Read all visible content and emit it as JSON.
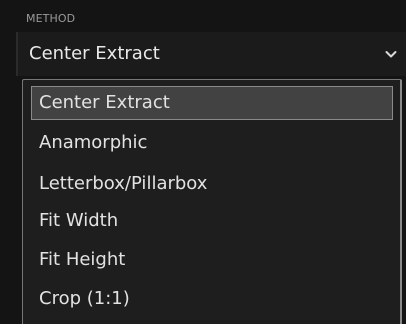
{
  "method": {
    "label": "METHOD",
    "selected_value": "Center Extract",
    "chevron_icon": "chevron-down-icon",
    "options": [
      {
        "label": "Center Extract",
        "selected": true
      },
      {
        "label": "Anamorphic",
        "selected": false
      },
      {
        "label": "Letterbox/Pillarbox",
        "selected": false
      },
      {
        "label": "Fit Width",
        "selected": false
      },
      {
        "label": "Fit Height",
        "selected": false
      },
      {
        "label": "Crop (1:1)",
        "selected": false
      }
    ]
  }
}
